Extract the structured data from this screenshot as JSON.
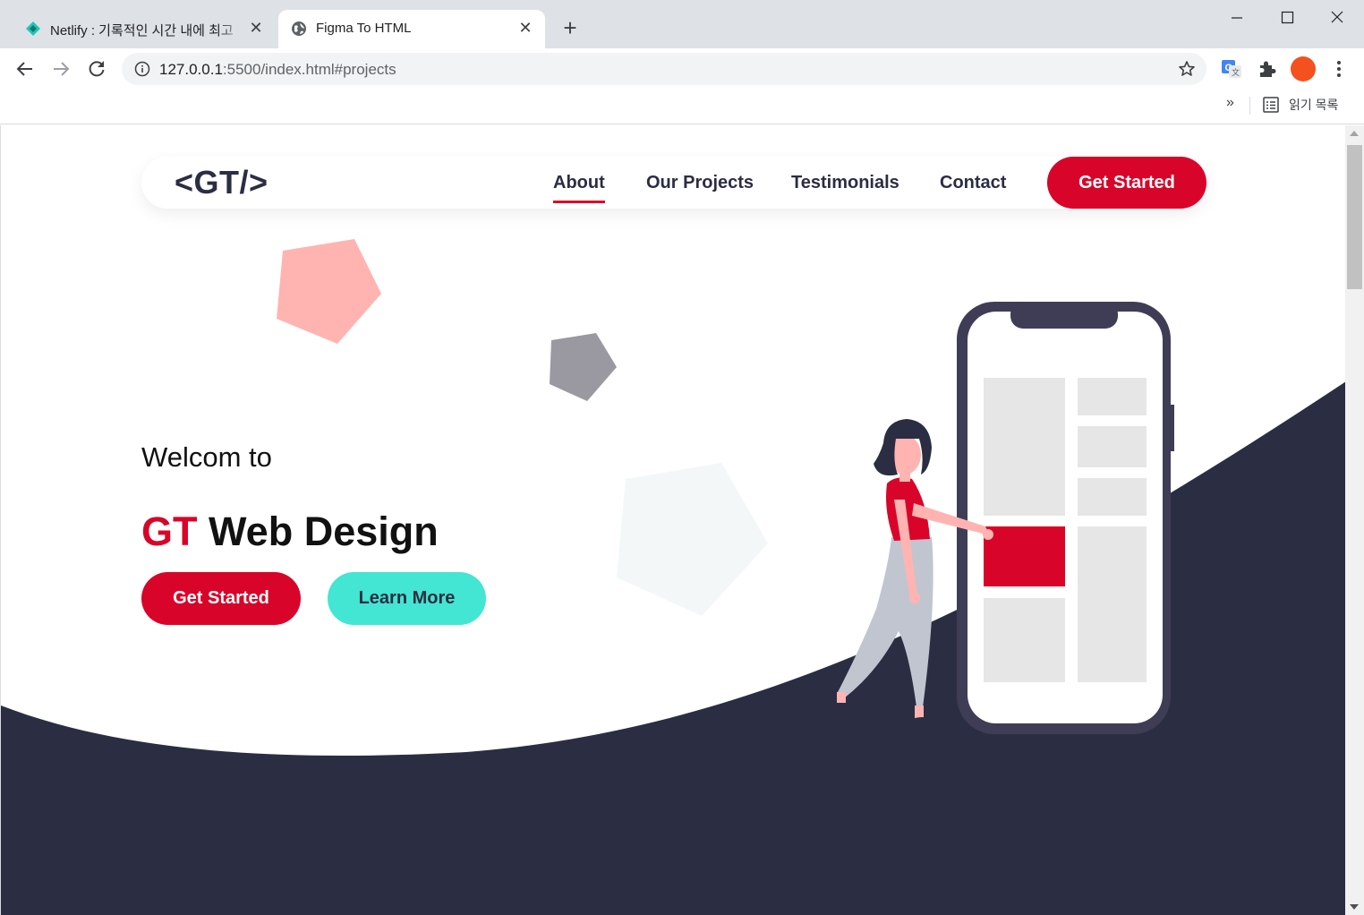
{
  "browser": {
    "tabs": [
      {
        "title": "Netlify : 기록적인 시간 내에 최고",
        "active": false,
        "favicon": "netlify-icon"
      },
      {
        "title": "Figma To HTML",
        "active": true,
        "favicon": "globe-icon"
      }
    ],
    "url_host": "127.0.0.1",
    "url_rest": ":5500/index.html#projects",
    "bookmarks_overflow": "»",
    "reading_list_label": "읽기 목록",
    "profile_color": "#f4511e"
  },
  "site": {
    "logo": "<GT/>",
    "nav": {
      "about": "About",
      "projects": "Our Projects",
      "testimonials": "Testimonials",
      "contact": "Contact",
      "cta": "Get Started"
    },
    "hero": {
      "welcome": "Welcom to",
      "title_accent": "GT",
      "title_rest": "Web Design",
      "primary_button": "Get Started",
      "secondary_button": "Learn More"
    },
    "colors": {
      "accent": "#d90429",
      "dark": "#2b2d42",
      "teal": "#42e6d3",
      "pink_shape": "#ffb4b2",
      "gray_shape": "#9a99a2"
    }
  }
}
